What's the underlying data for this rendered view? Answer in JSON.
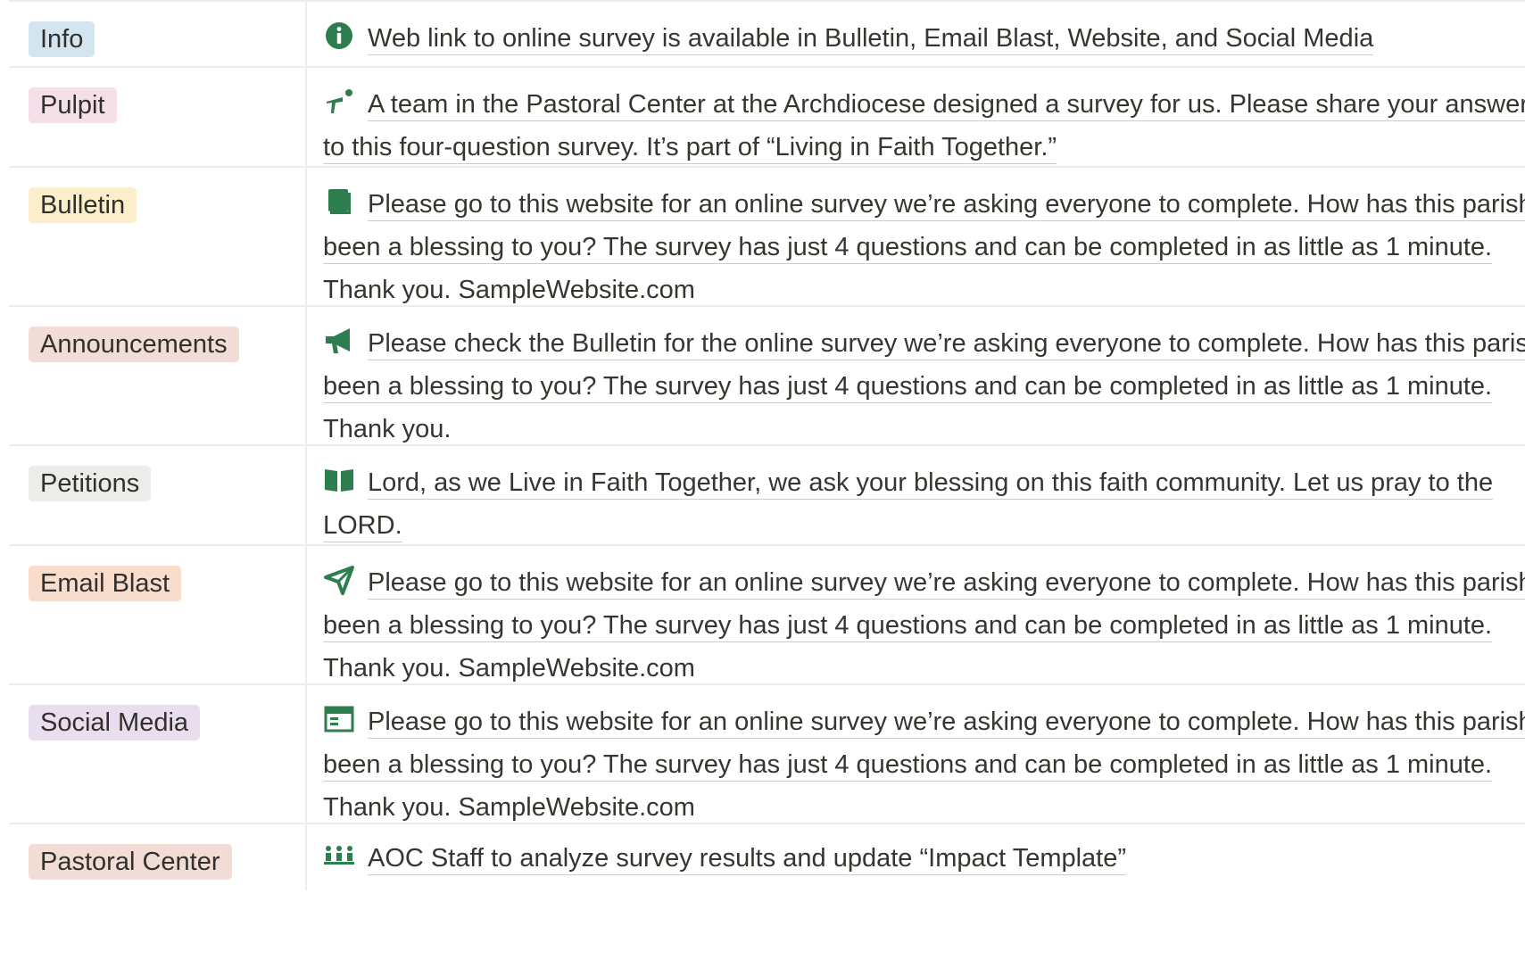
{
  "colors": {
    "icon_green": "#2e7d4f",
    "border": "#ededec",
    "tag_info": "#d3e5ef",
    "tag_pulpit": "#f5e0e9",
    "tag_bulletin": "#fbeecb",
    "tag_announcements": "#f1dcd6",
    "tag_petitions": "#ececeb",
    "tag_email": "#f9ddcc",
    "tag_social": "#e8deee",
    "tag_pastoral": "#f1dcd6"
  },
  "rows": [
    {
      "tag": "Info",
      "icon": "info-icon",
      "text": "Web link to online survey is available in Bulletin, Email Blast, Website, and Social Media"
    },
    {
      "tag": "Pulpit",
      "icon": "pulpit-icon",
      "text": "A team in the Pastoral Center at the Archdiocese designed a survey for us. Please share your answers to this four-question survey. It’s part of “Living in Faith Together.”"
    },
    {
      "tag": "Bulletin",
      "icon": "book-icon",
      "text": "Please go to this website for an online survey we’re asking everyone to complete. How has this parish been a blessing to you? The survey has just 4 questions and can be completed in as little as 1 minute. Thank you. SampleWebsite.com"
    },
    {
      "tag": "Announcements",
      "icon": "megaphone-icon",
      "text": "Please check the Bulletin for the online survey we’re asking everyone to complete. How has this parish been a blessing to you? The survey has just 4 questions and can be completed in as little as 1 minute. Thank you."
    },
    {
      "tag": "Petitions",
      "icon": "open-book-icon",
      "text": "Lord, as we Live in Faith Together, we ask your blessing on this faith community. Let us pray to the LORD."
    },
    {
      "tag": "Email Blast",
      "icon": "send-icon",
      "text": "Please go to this website for an online survey we’re asking everyone to complete. How has this parish been a blessing to you? The survey has just 4 questions and can be completed in as little as 1 minute. Thank you. SampleWebsite.com"
    },
    {
      "tag": "Social Media",
      "icon": "browser-window-icon",
      "text": "Please go to this website for an online survey we’re asking everyone to complete. How has this parish been a blessing to you? The survey has just 4 questions and can be completed in as little as 1 minute. Thank you. SampleWebsite.com"
    },
    {
      "tag": "Pastoral Center",
      "icon": "team-icon",
      "text": "AOC Staff to analyze survey results and update “Impact Template”"
    }
  ]
}
